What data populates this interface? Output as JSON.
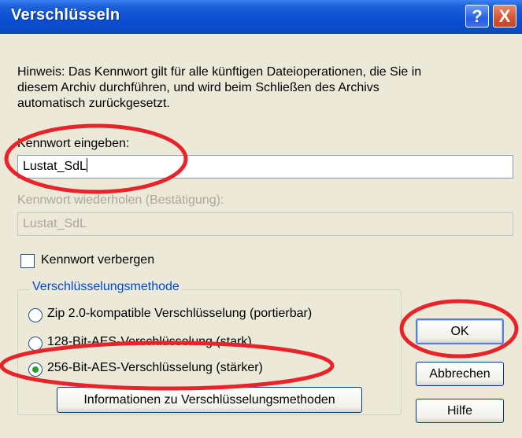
{
  "window": {
    "title": "Verschlüsseln",
    "help_glyph": "?",
    "close_glyph": "X"
  },
  "hint": {
    "line1": "Hinweis: Das Kennwort gilt für alle künftigen Dateioperationen, die Sie in",
    "line2": "diesem Archiv durchführen, und wird beim Schließen des Archivs",
    "line3": "automatisch zurückgesetzt."
  },
  "password": {
    "label": "Kennwort eingeben:",
    "value": "Lustat_SdL"
  },
  "confirm": {
    "label": "Kennwort wiederholen (Bestätigung):",
    "value": "Lustat_SdL"
  },
  "hide_password": {
    "label": "Kennwort verbergen",
    "checked": false
  },
  "method": {
    "group_title": "Verschlüsselungsmethode",
    "options": [
      {
        "label": "Zip 2.0-kompatible Verschlüsselung (portierbar)",
        "selected": false
      },
      {
        "label": "128-Bit-AES-Verschlüsselung (stark)",
        "selected": false
      },
      {
        "label": "256-Bit-AES-Verschlüsselung (stärker)",
        "selected": true
      }
    ],
    "info_button": "Informationen zu Verschlüsselungsmethoden"
  },
  "buttons": {
    "ok": "OK",
    "cancel": "Abbrechen",
    "help": "Hilfe"
  },
  "colors": {
    "titlebar": "#0a4ed3",
    "group_title": "#0046d5",
    "annotation": "#e8242a",
    "radio_selected": "#21a121"
  }
}
